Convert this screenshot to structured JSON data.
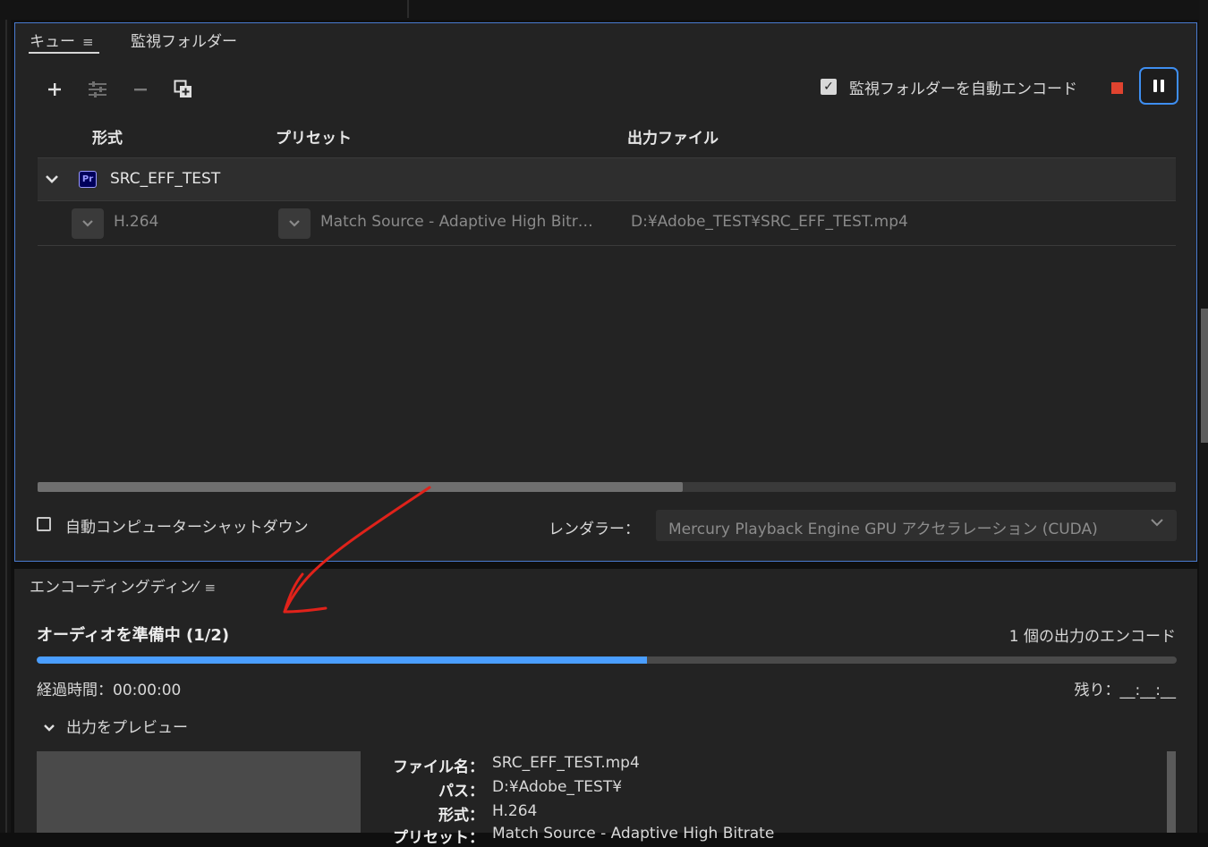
{
  "queue": {
    "tabs": [
      "キュー",
      "監視フォルダー"
    ],
    "menu_icon": "hamburger-icon",
    "toolbar": {
      "add_icon": "plus-icon",
      "settings_icon": "sliders-icon",
      "remove_icon": "minus-icon",
      "duplicate_icon": "duplicate-icon"
    },
    "auto_encode_label": "監視フォルダーを自動エンコード",
    "auto_encode_checked": true,
    "stop_color": "#e0432f",
    "pause_focus_color": "#3e8ef0",
    "columns": [
      "形式",
      "プリセット",
      "出力ファイル"
    ],
    "group": {
      "badge": "Pr",
      "name": "SRC_EFF_TEST",
      "items": [
        {
          "format": "H.264",
          "preset": "Match Source - Adaptive High Bitr…",
          "output": "D:¥Adobe_TEST¥SRC_EFF_TEST.mp4"
        }
      ]
    },
    "shutdown_label": "自動コンピューターシャットダウン",
    "renderer_label": "レンダラー：",
    "renderer_value": "Mercury Playback Engine GPU アクセラレーション (CUDA)"
  },
  "encoding": {
    "title": "エンコーディングディン⁄",
    "status": "オーディオを準備中 (1/2)",
    "count_label": "1 個の出力のエンコード",
    "progress": 0.535,
    "progress_color": "#4a9eff",
    "elapsed": "経過時間：00:00:00",
    "remaining": "残り：__:__:__",
    "preview_toggle": "出力をプレビュー",
    "info": [
      {
        "key": "ファイル名：",
        "value": "SRC_EFF_TEST.mp4"
      },
      {
        "key": "パス：",
        "value": "D:¥Adobe_TEST¥"
      },
      {
        "key": "形式：",
        "value": "H.264"
      },
      {
        "key": "プリセット：",
        "value": "Match Source - Adaptive High Bitrate"
      }
    ]
  },
  "annotation_color": "#e0221a"
}
